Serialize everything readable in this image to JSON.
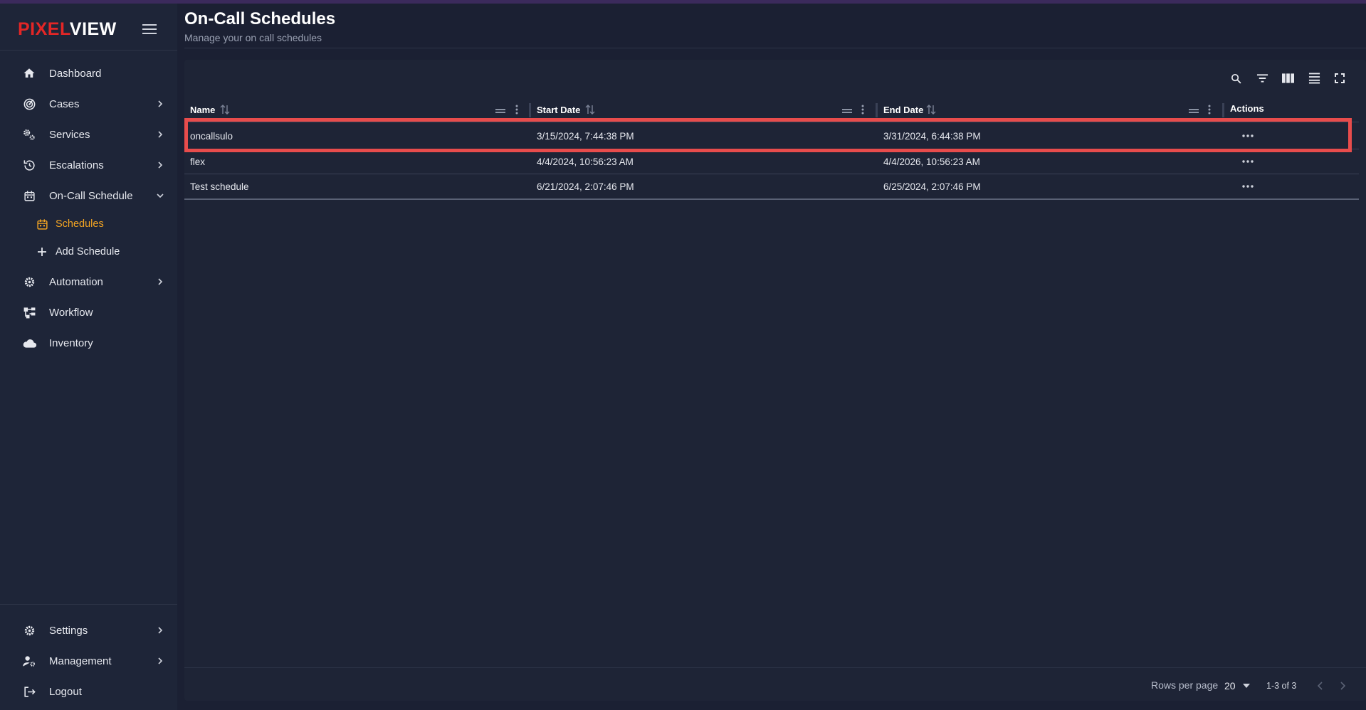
{
  "brand": {
    "part1": "PIXEL",
    "part2": "VIEW"
  },
  "sidebar": {
    "items": [
      {
        "label": "Dashboard",
        "icon": "home-icon"
      },
      {
        "label": "Cases",
        "icon": "radar-icon"
      },
      {
        "label": "Services",
        "icon": "gears-icon"
      },
      {
        "label": "Escalations",
        "icon": "escalation-icon"
      },
      {
        "label": "On-Call Schedule",
        "icon": "calendar-icon"
      },
      {
        "label": "Schedules",
        "icon": "calendar-icon"
      },
      {
        "label": "Add Schedule",
        "icon": "plus-icon"
      },
      {
        "label": "Automation",
        "icon": "gear-icon"
      },
      {
        "label": "Workflow",
        "icon": "workflow-icon"
      },
      {
        "label": "Inventory",
        "icon": "cloud-icon"
      }
    ],
    "bottom": [
      {
        "label": "Settings",
        "icon": "gear-icon"
      },
      {
        "label": "Management",
        "icon": "user-gear-icon"
      },
      {
        "label": "Logout",
        "icon": "logout-icon"
      }
    ]
  },
  "header": {
    "title": "On-Call Schedules",
    "subtitle": "Manage your on call schedules"
  },
  "table": {
    "columns": [
      "Name",
      "Start Date",
      "End Date",
      "Actions"
    ],
    "rows": [
      {
        "name": "oncallsulo",
        "start": "3/15/2024, 7:44:38 PM",
        "end": "3/31/2024, 6:44:38 PM"
      },
      {
        "name": "flex",
        "start": "4/4/2024, 10:56:23 AM",
        "end": "4/4/2026, 10:56:23 AM"
      },
      {
        "name": "Test schedule",
        "start": "6/21/2024, 2:07:46 PM",
        "end": "6/25/2024, 2:07:46 PM"
      }
    ]
  },
  "pagination": {
    "rows_per_page_label": "Rows per page",
    "rows_per_page": "20",
    "range": "1-3 of 3"
  },
  "colors": {
    "background": "#1b2033",
    "sidebar": "#1e2538",
    "accent": "#f5a623",
    "brand_red": "#e32626",
    "highlight": "#e84c4c"
  }
}
